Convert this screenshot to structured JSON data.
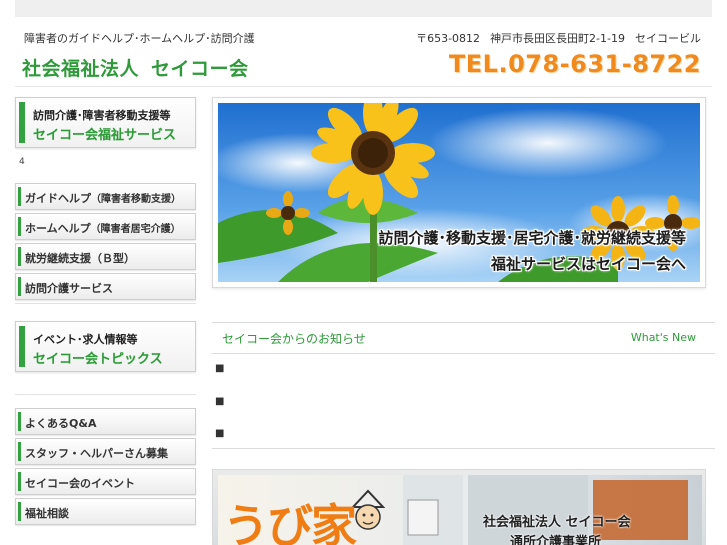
{
  "header": {
    "tagline": "障害者のガイドヘルプ･ホームヘルプ･訪問介護",
    "logo_prefix": "社会福祉法人",
    "logo_name": "セイコー会",
    "postal": "〒653-0812",
    "address": "神戸市長田区長田町2-1-19",
    "building": "セイコービル",
    "tel": "TEL.078-631-8722"
  },
  "sidebar": {
    "service_banner": {
      "line1": "訪問介護･障害者移動支援等",
      "line2": "セイコー会福祉サービス"
    },
    "stray_text": "4",
    "services": [
      {
        "label": "ガイドヘルプ",
        "sub": "（障害者移動支援）"
      },
      {
        "label": "ホームヘルプ",
        "sub": "（障害者居宅介護）"
      },
      {
        "label": "就労継続支援（Ｂ型）",
        "sub": ""
      },
      {
        "label": "訪問介護サービス",
        "sub": ""
      }
    ],
    "topics_banner": {
      "line1": "イベント･求人情報等",
      "line2": "セイコー会トピックス"
    },
    "links": [
      {
        "label": "よくあるQ&A"
      },
      {
        "label": "スタッフ・ヘルパーさん募集"
      },
      {
        "label": "セイコー会のイベント"
      },
      {
        "label": "福祉相談"
      }
    ]
  },
  "hero": {
    "line1": "訪問介護･移動支援･居宅介護･就労継続支援等",
    "line2": "福祉サービスはセイコー会へ"
  },
  "news": {
    "title": "セイコー会からのお知らせ",
    "link": "What's New",
    "items": [
      "■",
      "■",
      "■"
    ]
  },
  "bottom_banner": {
    "logo": "うび家",
    "line1": "社会福祉法人 セイコー会",
    "line2": "通所介護事業所"
  },
  "colors": {
    "accent_green": "#2f9a3a",
    "tel_orange": "#f08a1c"
  }
}
